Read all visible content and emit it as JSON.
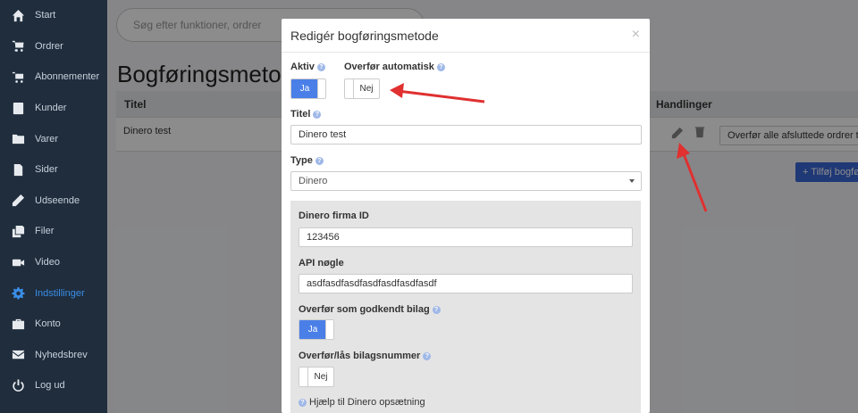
{
  "sidebar": {
    "items": [
      {
        "label": "Start",
        "icon": "home-icon"
      },
      {
        "label": "Ordrer",
        "icon": "cart-icon"
      },
      {
        "label": "Abonnementer",
        "icon": "cart-plus-icon"
      },
      {
        "label": "Kunder",
        "icon": "address-book-icon"
      },
      {
        "label": "Varer",
        "icon": "folder-icon"
      },
      {
        "label": "Sider",
        "icon": "file-icon"
      },
      {
        "label": "Udseende",
        "icon": "pencil-icon"
      },
      {
        "label": "Filer",
        "icon": "copy-icon"
      },
      {
        "label": "Video",
        "icon": "video-icon"
      },
      {
        "label": "Indstillinger",
        "icon": "gear-icon",
        "active": true
      },
      {
        "label": "Konto",
        "icon": "briefcase-icon"
      },
      {
        "label": "Nyhedsbrev",
        "icon": "envelope-icon"
      },
      {
        "label": "Log ud",
        "icon": "power-icon"
      }
    ]
  },
  "background": {
    "search_placeholder": "Søg efter funktioner, ordrer",
    "page_title": "Bogføringsmetoder",
    "table": {
      "col_title": "Titel",
      "col_actions": "Handlinger",
      "rows": [
        {
          "title": "Dinero test",
          "action_select": "Overfør alle afsluttede ordrer t"
        }
      ]
    },
    "add_button": "+ Tilføj bogføringsmetode"
  },
  "modal": {
    "title": "Redigér bogføringsmetode",
    "close": "×",
    "aktiv": {
      "label": "Aktiv",
      "value": "Ja"
    },
    "auto_transfer": {
      "label": "Overfør automatisk",
      "value": "Nej"
    },
    "titel": {
      "label": "Titel",
      "value": "Dinero test"
    },
    "type": {
      "label": "Type",
      "value": "Dinero"
    },
    "dinero": {
      "firm_id": {
        "label": "Dinero firma ID",
        "value": "123456"
      },
      "api_key": {
        "label": "API nøgle",
        "value": "asdfasdfasdfasdfasdfasdfasdf"
      },
      "approved": {
        "label": "Overfør som godkendt bilag",
        "value": "Ja"
      },
      "lock_number": {
        "label": "Overfør/lås bilagsnummer",
        "value": "Nej"
      },
      "help_link": "Hjælp til Dinero opsætning"
    }
  },
  "colors": {
    "sidebar_bg": "#1f2d3d",
    "accent": "#4a7fe8",
    "active_item": "#3a8ee6",
    "annotation_arrow": "#e03030"
  }
}
